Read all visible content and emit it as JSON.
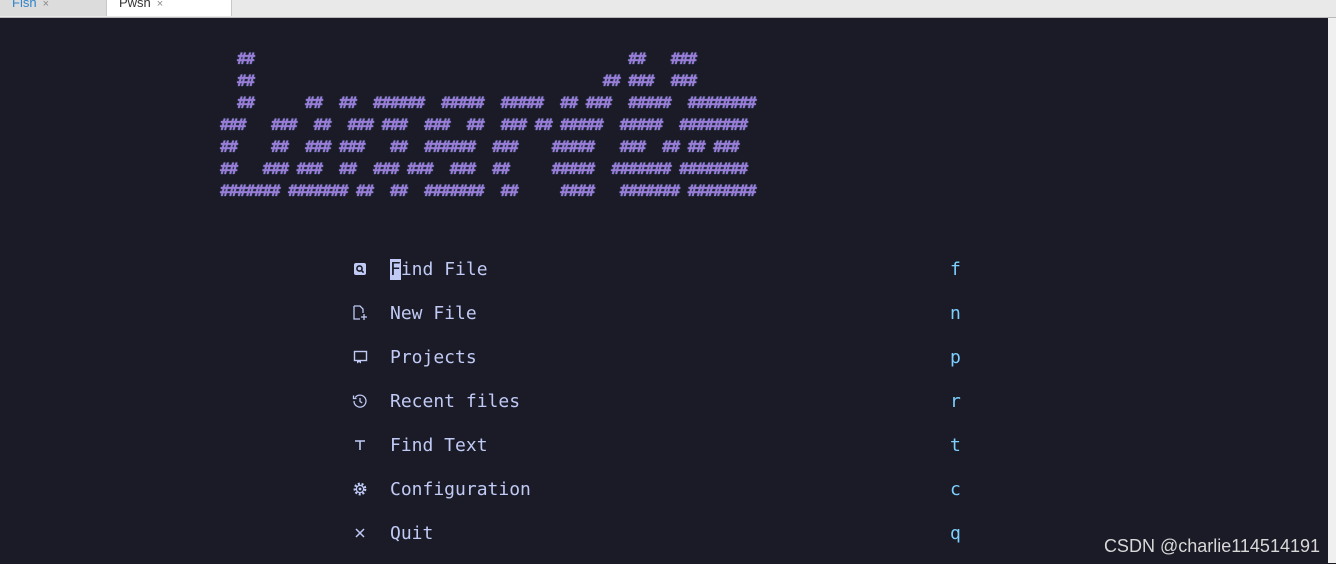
{
  "tabs": [
    {
      "label": "Fish",
      "close": "×"
    },
    {
      "label": "Pwsh",
      "close": "×"
    }
  ],
  "logo_art": "  ##                                            ##   ###\n  ##                                         ## ###  ###\n  ##      ##  ##  ######  #####  #####  ## ###  #####  ########\n###   ###  ##  ### ###  ###  ##  ### ## #####  #####  ########\n##    ##  ### ###   ##  ######  ###    #####   ###  ## ## ###\n##   ### ###  ##  ### ###  ###  ##     #####  ####### ########\n####### ####### ##  ##  #######  ##     ####   ####### ########",
  "menu": [
    {
      "icon": "search-file-icon",
      "label": "Find File",
      "key": "f"
    },
    {
      "icon": "new-file-icon",
      "label": "New File",
      "key": "n"
    },
    {
      "icon": "projects-icon",
      "label": "Projects",
      "key": "p"
    },
    {
      "icon": "history-icon",
      "label": "Recent files",
      "key": "r"
    },
    {
      "icon": "text-icon",
      "label": "Find Text",
      "key": "t"
    },
    {
      "icon": "gear-icon",
      "label": "Configuration",
      "key": "c"
    },
    {
      "icon": "close-icon",
      "label": "Quit",
      "key": "q"
    }
  ],
  "watermark": "CSDN @charlie114514191",
  "colors": {
    "background": "#1a1b26",
    "logo": "#9d7cd8",
    "text": "#c0caf5",
    "key": "#7dcfff"
  }
}
